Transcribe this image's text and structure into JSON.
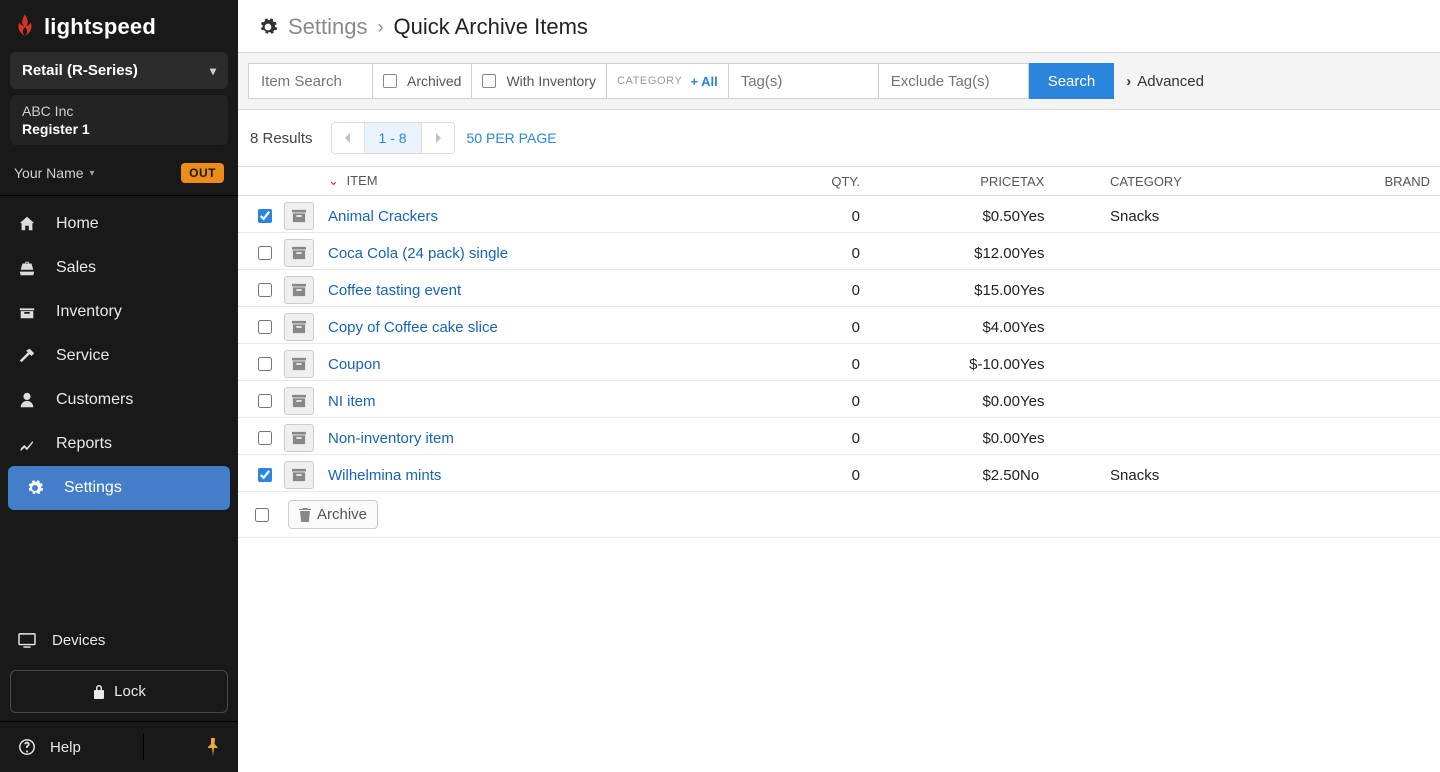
{
  "brand": {
    "name": "lightspeed"
  },
  "sidebar": {
    "product_selector": "Retail (R-Series)",
    "company": "ABC Inc",
    "register": "Register 1",
    "user_name": "Your Name",
    "badge": "OUT",
    "nav": [
      {
        "label": "Home",
        "icon": "home-icon"
      },
      {
        "label": "Sales",
        "icon": "cash-register-icon"
      },
      {
        "label": "Inventory",
        "icon": "box-icon"
      },
      {
        "label": "Service",
        "icon": "hammer-icon"
      },
      {
        "label": "Customers",
        "icon": "user-icon"
      },
      {
        "label": "Reports",
        "icon": "chart-icon"
      },
      {
        "label": "Settings",
        "icon": "gear-icon",
        "selected": true
      }
    ],
    "devices": "Devices",
    "lock": "Lock",
    "help": "Help"
  },
  "header": {
    "crumb1": "Settings",
    "crumb2": "Quick Archive Items"
  },
  "filters": {
    "search_placeholder": "Item Search",
    "archived": "Archived",
    "with_inventory": "With Inventory",
    "category_label": "CATEGORY",
    "category_all": "All",
    "tags_placeholder": "Tag(s)",
    "exclude_placeholder": "Exclude Tag(s)",
    "search_btn": "Search",
    "advanced": "Advanced"
  },
  "pager": {
    "results": "8 Results",
    "range": "1 - 8",
    "per_page": "50 PER PAGE"
  },
  "table": {
    "cols": {
      "item": "ITEM",
      "qty": "QTY.",
      "price": "PRICE",
      "tax": "TAX",
      "category": "CATEGORY",
      "brand": "BRAND"
    },
    "rows": [
      {
        "checked": true,
        "name": "Animal Crackers",
        "qty": "0",
        "price": "$0.50",
        "tax": "Yes",
        "category": "Snacks",
        "brand": ""
      },
      {
        "checked": false,
        "name": "Coca Cola (24 pack) single",
        "qty": "0",
        "price": "$12.00",
        "tax": "Yes",
        "category": "",
        "brand": ""
      },
      {
        "checked": false,
        "name": "Coffee tasting event",
        "qty": "0",
        "price": "$15.00",
        "tax": "Yes",
        "category": "",
        "brand": ""
      },
      {
        "checked": false,
        "name": "Copy of Coffee cake slice",
        "qty": "0",
        "price": "$4.00",
        "tax": "Yes",
        "category": "",
        "brand": ""
      },
      {
        "checked": false,
        "name": "Coupon",
        "qty": "0",
        "price": "$-10.00",
        "tax": "Yes",
        "category": "",
        "brand": ""
      },
      {
        "checked": false,
        "name": "NI item",
        "qty": "0",
        "price": "$0.00",
        "tax": "Yes",
        "category": "",
        "brand": ""
      },
      {
        "checked": false,
        "name": "Non-inventory item",
        "qty": "0",
        "price": "$0.00",
        "tax": "Yes",
        "category": "",
        "brand": ""
      },
      {
        "checked": true,
        "name": "Wilhelmina mints",
        "qty": "0",
        "price": "$2.50",
        "tax": "No",
        "category": "Snacks",
        "brand": ""
      }
    ],
    "archive_btn": "Archive"
  }
}
